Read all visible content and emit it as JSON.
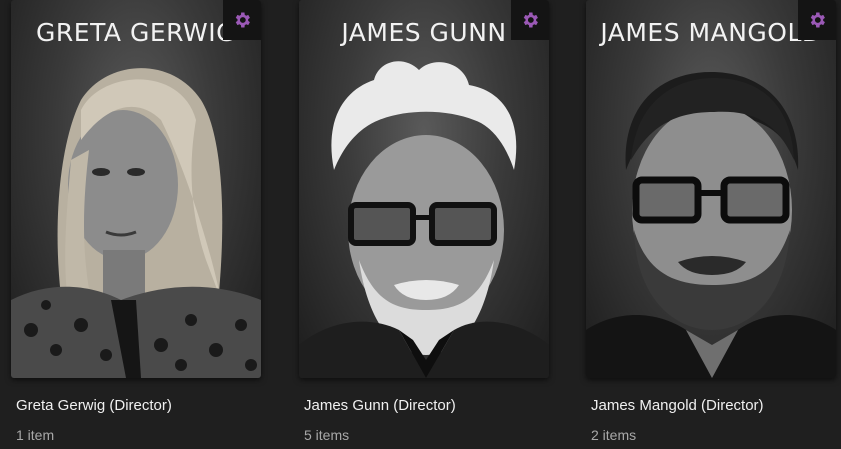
{
  "accent_color": "#9b59b6",
  "cards": [
    {
      "poster_name": "GRETA GERWIG",
      "title": "Greta Gerwig (Director)",
      "count": "1 item",
      "menu_icon": "gear-icon"
    },
    {
      "poster_name": "JAMES GUNN",
      "title": "James Gunn (Director)",
      "count": "5 items",
      "menu_icon": "gear-icon"
    },
    {
      "poster_name": "JAMES MANGOLD",
      "title": "James Mangold (Director)",
      "count": "2 items",
      "menu_icon": "gear-icon"
    }
  ]
}
